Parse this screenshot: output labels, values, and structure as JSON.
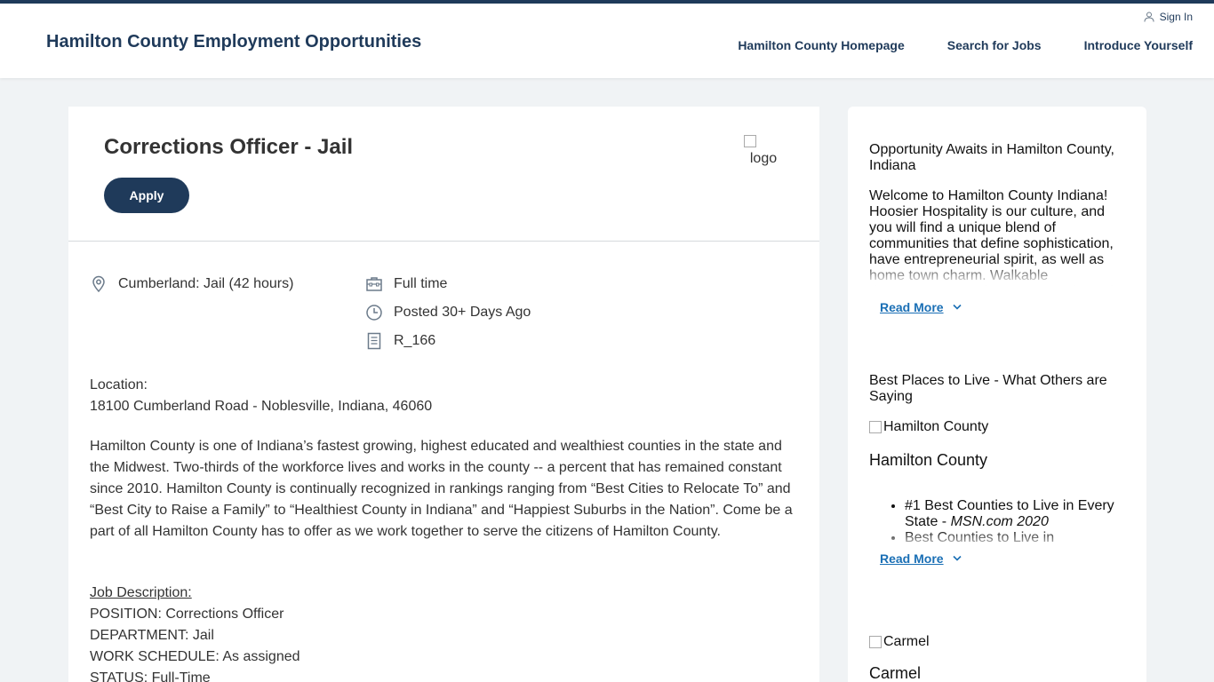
{
  "header": {
    "site_title": "Hamilton County Employment Opportunities",
    "sign_in": "Sign In",
    "nav": [
      "Hamilton County Homepage",
      "Search for Jobs",
      "Introduce Yourself"
    ]
  },
  "job": {
    "title": "Corrections Officer - Jail",
    "apply_label": "Apply",
    "logo_alt": "logo",
    "location": "Cumberland: Jail (42 hours)",
    "time_type": "Full time",
    "posted": "Posted 30+ Days Ago",
    "req_id": "R_166",
    "location_label": "Location:",
    "address": "18100 Cumberland Road - Noblesville, Indiana, 46060",
    "intro": "Hamilton County is one of Indiana’s fastest growing, highest educated and wealthiest counties in the state and the Midwest. Two-thirds of the workforce lives and works in the county -- a percent that has remained constant since 2010.  Hamilton County is continually recognized in rankings ranging from “Best Cities to Relocate To” and “Best City to Raise a Family” to “Healthiest County in Indiana” and “Happiest Suburbs in the Nation”.  Come be a part of all Hamilton County has to offer as we work together to serve the citizens of Hamilton County.",
    "jd_heading": "Job Description:",
    "jd_lines": [
      "POSITION:  Corrections Officer",
      "DEPARTMENT:  Jail",
      "WORK SCHEDULE:  As assigned",
      "STATUS:  Full-Time"
    ]
  },
  "sidebar": {
    "section1": {
      "heading": "Opportunity Awaits in Hamilton County, Indiana",
      "text": "Welcome to Hamilton County Indiana! Hoosier Hospitality is our culture, and you will find a unique blend of communities that define sophistication, have entrepreneurial spirit, as well as home town charm. Walkable downtowns, waterfront access, dynamic",
      "read_more": "Read More"
    },
    "section2": {
      "heading": "Best Places to Live - What Others are Saying",
      "image_alt": "Hamilton County",
      "caption": "Hamilton County",
      "bullet1_text": "#1 Best Counties to Live in Every State - ",
      "bullet1_source": "MSN.com 2020",
      "bullet2_text": "Best Counties to Live in",
      "read_more": "Read More"
    },
    "section3": {
      "image_alt": "Carmel",
      "caption": "Carmel"
    }
  }
}
